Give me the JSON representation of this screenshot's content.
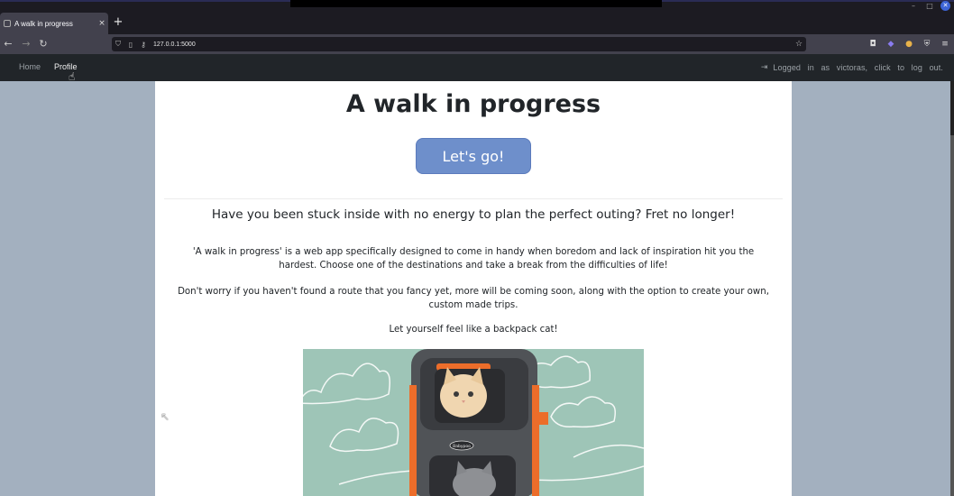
{
  "browser": {
    "tab_title": "A walk in progress",
    "tab_close": "×",
    "new_tab": "+",
    "url": "127.0.0.1:5000",
    "window_controls": [
      "–",
      "□",
      "✕"
    ]
  },
  "navbar": {
    "home_label": "Home",
    "profile_label": "Profile",
    "logout_text": "Logged in as victoras, click to log out."
  },
  "main": {
    "title": "A walk in progress",
    "go_button": "Let's go!",
    "lead": "Have you been stuck inside with no energy to plan the perfect outing? Fret no longer!",
    "paragraph1": "'A walk in progress' is a web app specifically designed to come in handy when boredom and lack of inspiration hit you the hardest. Choose one of the destinations and take a break from the difficulties of life!",
    "paragraph2": "Don't worry if you haven't found a route that you fancy yet, more will be coming soon, along with the option to create your own, custom made trips.",
    "paragraph3": "Let yourself feel like a backpack cat!",
    "image_brand": "Babypoo"
  },
  "colors": {
    "accent_button": "#6e8fcb",
    "page_background": "#a3b0bf",
    "navbar": "#212529"
  },
  "icons": [
    "back-icon",
    "forward-icon",
    "reload-icon",
    "shield-icon",
    "page-icon",
    "key-icon",
    "star-icon",
    "pocket-icon",
    "extension-icon",
    "account-icon",
    "menu-icon",
    "logout-icon"
  ]
}
